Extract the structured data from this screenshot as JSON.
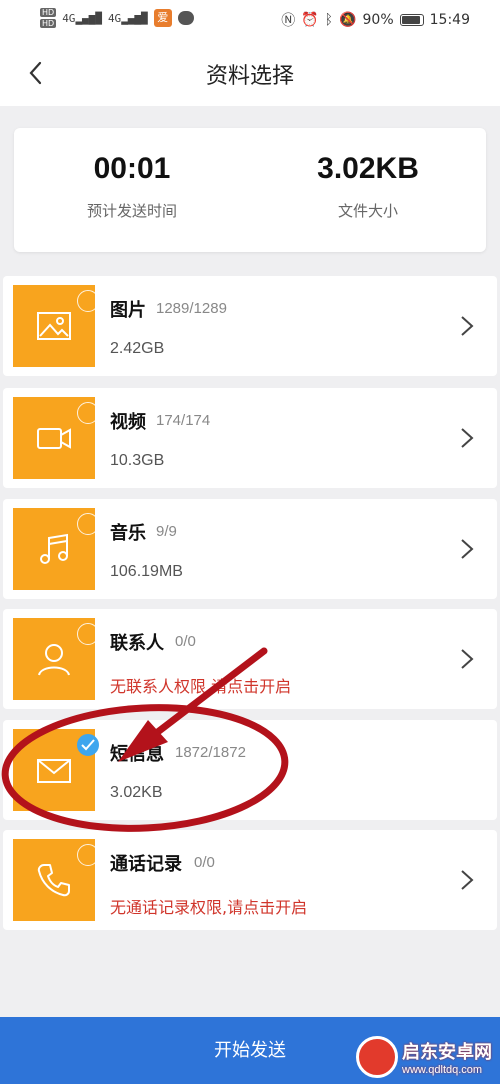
{
  "statusbar": {
    "sig1": "4G",
    "sig2": "4G",
    "app_badge": "爱",
    "battery": "90%",
    "time": "15:49"
  },
  "header": {
    "title": "资料选择"
  },
  "summary": {
    "time_value": "00:01",
    "time_label": "预计发送时间",
    "size_value": "3.02KB",
    "size_label": "文件大小"
  },
  "categories": [
    {
      "title": "图片",
      "count": "1289/1289",
      "size": "2.42GB",
      "icon": "image-icon",
      "selected": false
    },
    {
      "title": "视频",
      "count": "174/174",
      "size": "10.3GB",
      "icon": "video-icon",
      "selected": false
    },
    {
      "title": "音乐",
      "count": "9/9",
      "size": "106.19MB",
      "icon": "music-icon",
      "selected": false
    },
    {
      "title": "联系人",
      "count": "0/0",
      "warning": "无联系人权限,请点击开启",
      "icon": "contact-icon",
      "selected": false
    },
    {
      "title": "短信息",
      "count": "1872/1872",
      "size": "3.02KB",
      "icon": "message-icon",
      "selected": true
    },
    {
      "title": "通话记录",
      "count": "0/0",
      "warning": "无通话记录权限,请点击开启",
      "icon": "phone-icon",
      "selected": false
    }
  ],
  "footer": {
    "send_label": "开始发送"
  },
  "watermark": {
    "name": "启东安卓网",
    "url": "www.qdltdq.com"
  },
  "colors": {
    "accent": "#2e74d8",
    "tile": "#f8a41e",
    "warning": "#d0352b",
    "check": "#3ea6ee",
    "annotation": "#b3121b"
  }
}
